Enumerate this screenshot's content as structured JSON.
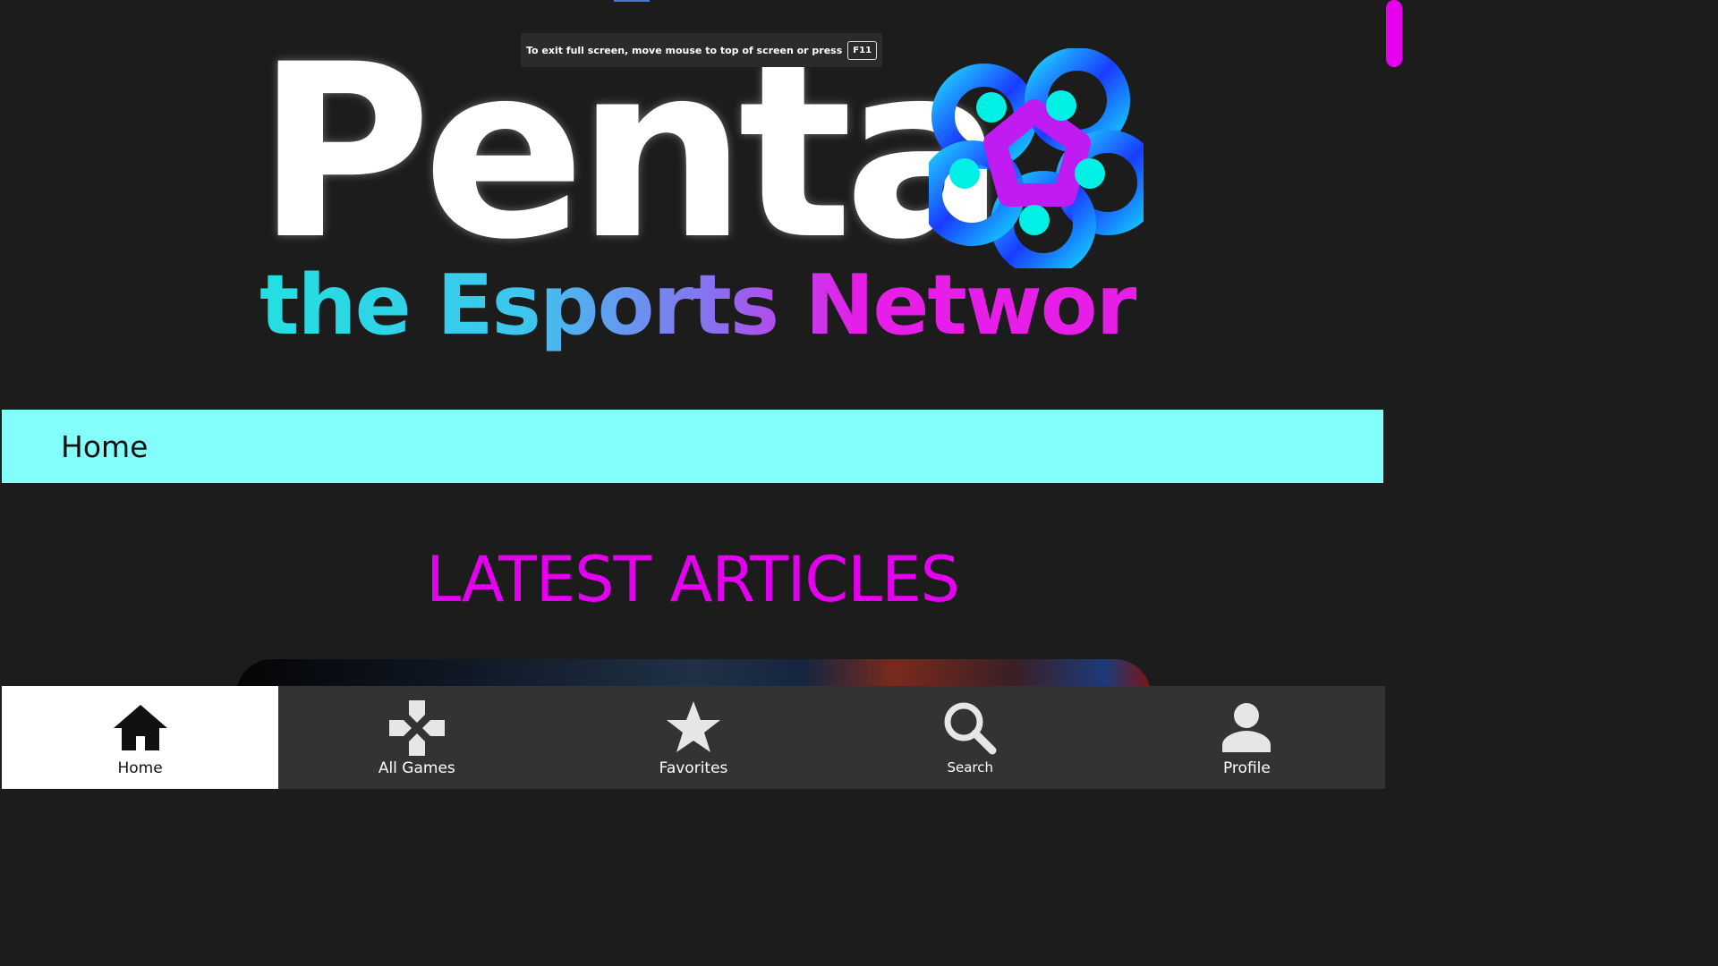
{
  "fullscreen_notice": {
    "text": "To exit full screen, move mouse to top of screen or press",
    "key": "F11"
  },
  "logo": {
    "word": "Penta",
    "tagline": "the Esports Network"
  },
  "breadcrumb": {
    "label": "Home"
  },
  "main": {
    "section_title": "LATEST ARTICLES"
  },
  "bottom_nav": {
    "items": [
      {
        "label": "Home",
        "icon": "home-icon",
        "active": true
      },
      {
        "label": "All Games",
        "icon": "gamepad-icon",
        "active": false
      },
      {
        "label": "Favorites",
        "icon": "star-icon",
        "active": false
      },
      {
        "label": "Search",
        "icon": "search-icon",
        "active": false
      },
      {
        "label": "Profile",
        "icon": "person-icon",
        "active": false
      }
    ]
  },
  "colors": {
    "background": "#1c1c1c",
    "breadcrumb_bar": "#84fefb",
    "accent_magenta": "#e200ee",
    "nav_background": "#333333",
    "nav_active": "#ffffff"
  }
}
